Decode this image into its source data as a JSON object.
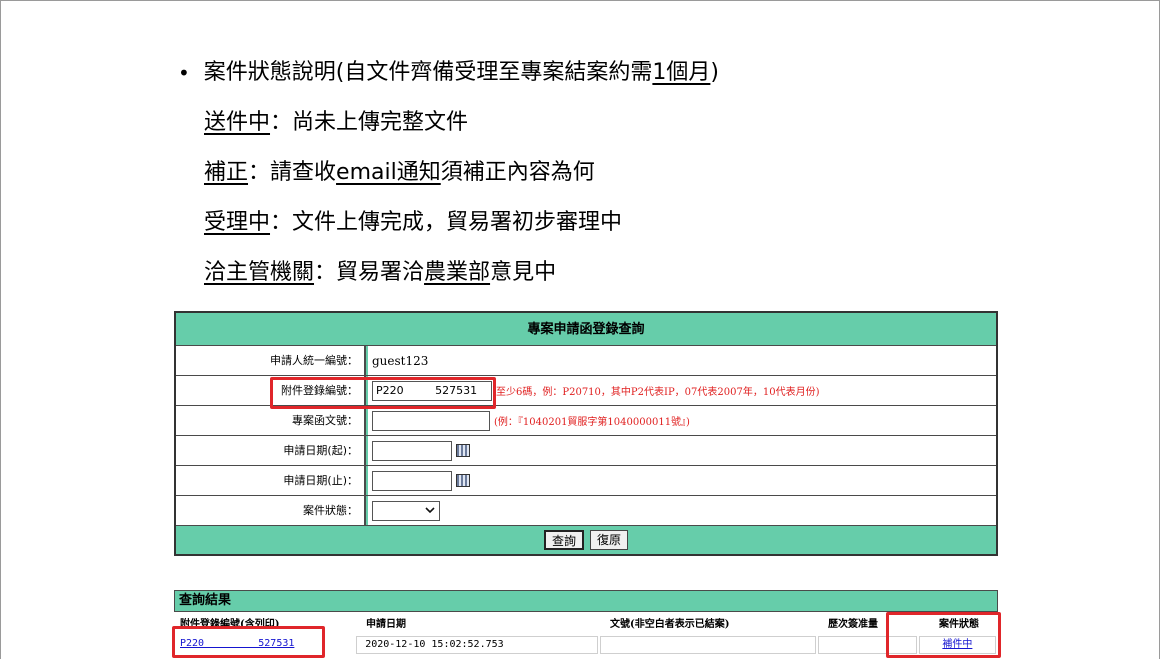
{
  "status_info": {
    "heading_main": "案件狀態說明(自文件齊備受理至專案結案約需",
    "heading_emph": "1個月",
    "heading_close": ")",
    "lines": [
      {
        "term": "送件中",
        "sep": "：",
        "desc": "尚未上傳完整文件"
      },
      {
        "term": "補正",
        "sep": "：",
        "desc_a": "請查收",
        "desc_emph": "email通知",
        "desc_b": "須補正內容為何"
      },
      {
        "term": "受理中",
        "sep": "：",
        "desc": "文件上傳完成，貿易署初步審理中"
      },
      {
        "term": "洽主管機關",
        "sep": "：",
        "desc_a": "貿易署洽",
        "desc_emph": "農業部",
        "desc_b": "意見中"
      }
    ]
  },
  "form": {
    "title": "專案申請函登錄查詢",
    "fields": {
      "applicant_id": {
        "label": "申請人統一編號：",
        "value": "guest123"
      },
      "attachment_no": {
        "label": "附件登錄編號：",
        "value": "P220         527531",
        "hint": "至少6碼，例：P20710，其中P2代表IP，07代表2007年，10代表月份)"
      },
      "doc_no": {
        "label": "專案函文號：",
        "value": "",
        "hint": "(例：『1040201貿服字第1040000011號』)"
      },
      "date_from": {
        "label": "申請日期(起)：",
        "value": ""
      },
      "date_to": {
        "label": "申請日期(止)：",
        "value": ""
      },
      "status": {
        "label": "案件狀態：",
        "value": ""
      }
    },
    "buttons": {
      "query": "查詢",
      "reset": "復原"
    }
  },
  "results": {
    "title": "查詢結果",
    "columns": [
      "附件登錄編號(含列印)",
      "申請日期",
      "文號(非空白者表示已結案)",
      "歷次簽准量",
      "案件狀態"
    ],
    "rows": [
      {
        "attachment_no": "P220         527531",
        "date": "2020-12-10 15:02:52.753",
        "doc_no": "",
        "approved_qty": "",
        "status": "補件中"
      }
    ]
  },
  "highlight_color": "#e0262a",
  "panel_color": "#66cdaa"
}
